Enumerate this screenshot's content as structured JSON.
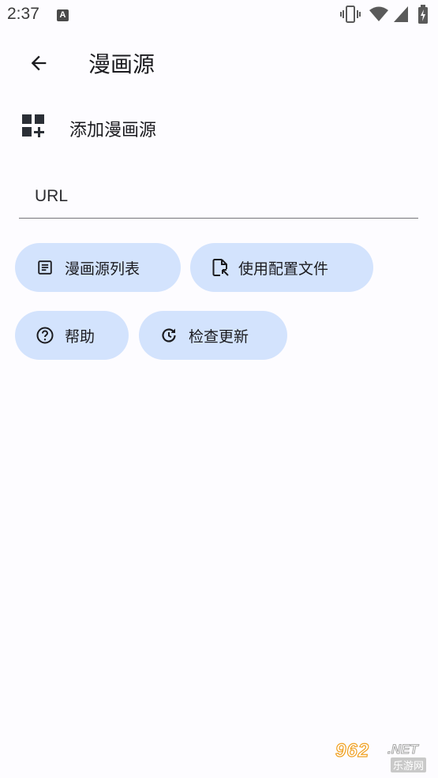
{
  "status_bar": {
    "time": "2:37",
    "notification_icon": "A",
    "icons": [
      "vibrate-icon",
      "wifi-icon",
      "signal-icon",
      "battery-charging-icon"
    ]
  },
  "app_bar": {
    "title": "漫画源",
    "back_icon": "arrow-back-icon"
  },
  "add_source": {
    "icon": "dashboard-add-icon",
    "label": "添加漫画源"
  },
  "url_field": {
    "placeholder": "URL",
    "value": ""
  },
  "chips": [
    {
      "label": "漫画源列表",
      "icon": "list-icon"
    },
    {
      "label": "使用配置文件",
      "icon": "file-import-icon"
    },
    {
      "label": "帮助",
      "icon": "help-icon"
    },
    {
      "label": "检查更新",
      "icon": "update-icon"
    }
  ],
  "watermark": {
    "brand": "962",
    "net": ".NET",
    "sub": "乐游网"
  },
  "colors": {
    "background": "#fdfcff",
    "chip": "#d3e3fd",
    "text": "#1b1b1f"
  }
}
